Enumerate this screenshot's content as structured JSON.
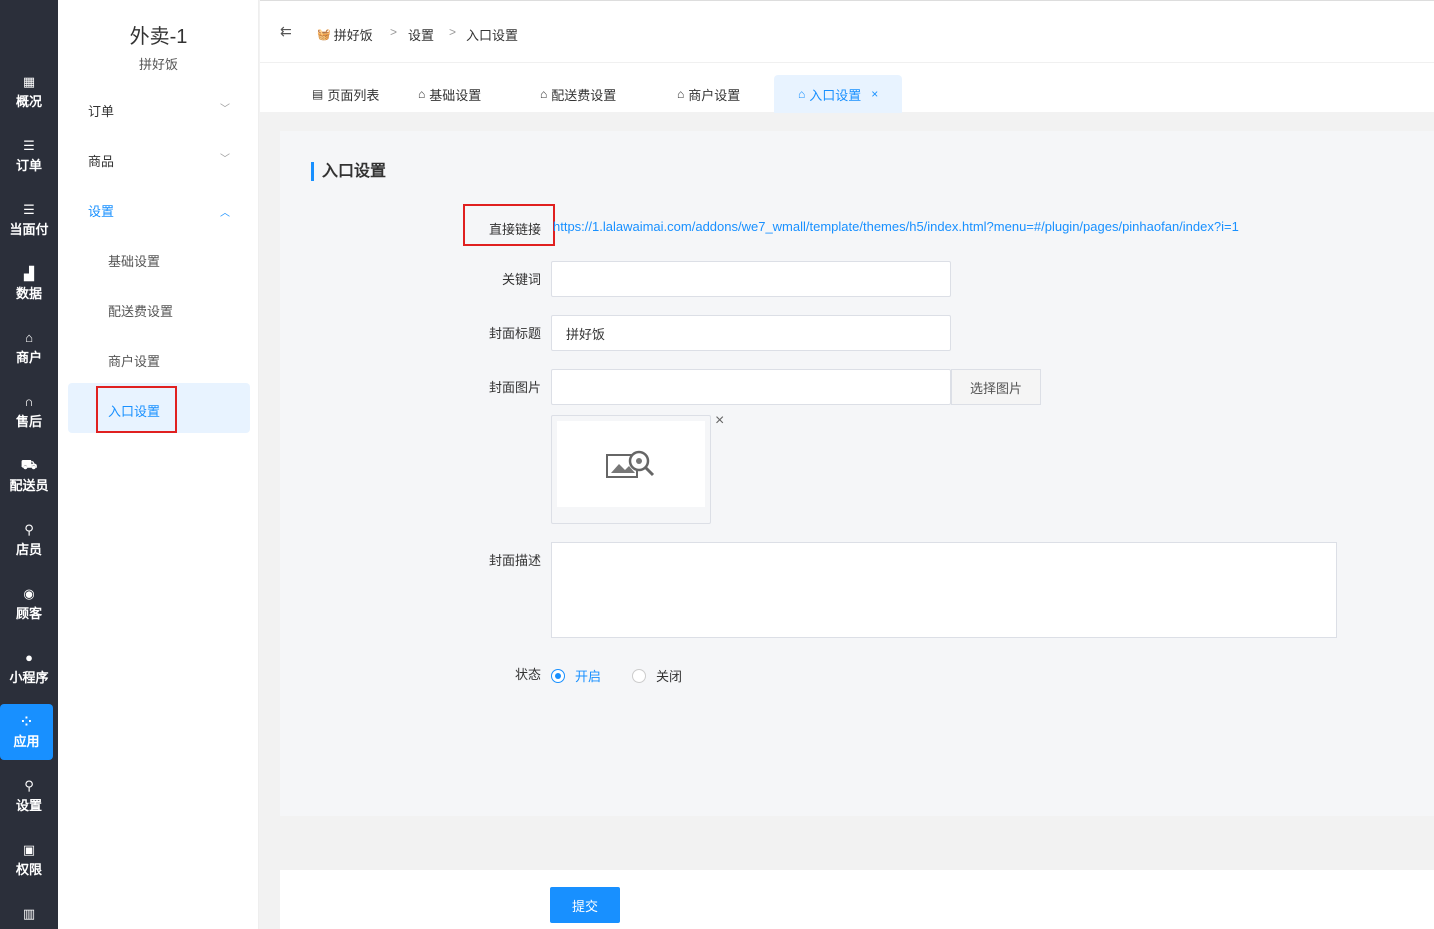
{
  "left_nav": {
    "items": [
      {
        "label": "概况",
        "icon": "dashboard-icon"
      },
      {
        "label": "订单",
        "icon": "list-icon"
      },
      {
        "label": "当面付",
        "icon": "list-icon"
      },
      {
        "label": "数据",
        "icon": "bar-chart-icon"
      },
      {
        "label": "商户",
        "icon": "store-icon"
      },
      {
        "label": "售后",
        "icon": "headset-icon"
      },
      {
        "label": "配送员",
        "icon": "scooter-icon"
      },
      {
        "label": "店员",
        "icon": "user-icon"
      },
      {
        "label": "顾客",
        "icon": "user-circle-icon"
      },
      {
        "label": "小程序",
        "icon": "wechat-icon"
      },
      {
        "label": "应用",
        "icon": "apps-icon"
      },
      {
        "label": "设置",
        "icon": "settings-user-icon"
      },
      {
        "label": "权限",
        "icon": "lock-icon"
      }
    ],
    "active": "应用"
  },
  "sub_nav": {
    "store_name": "外卖-1",
    "store_sub": "拼好饭",
    "groups": [
      {
        "label": "订单",
        "chevron": "﹀"
      },
      {
        "label": "商品",
        "chevron": "﹀"
      },
      {
        "label": "设置",
        "chevron": "︿"
      }
    ],
    "sub_items": [
      "基础设置",
      "配送费设置",
      "商户设置",
      "入口设置"
    ]
  },
  "breadcrumb": {
    "items": [
      "拼好饭",
      "设置",
      "入口设置"
    ],
    "sep": ">"
  },
  "tabs": [
    {
      "label": "页面列表"
    },
    {
      "label": "基础设置"
    },
    {
      "label": "配送费设置"
    },
    {
      "label": "商户设置"
    },
    {
      "label": "入口设置",
      "close": "×"
    }
  ],
  "form": {
    "section_title": "入口设置",
    "direct_link_label": "直接链接",
    "direct_link_value": "https://1.lalawaimai.com/addons/we7_wmall/template/themes/h5/index.html?menu=#/plugin/pages/pinhaofan/index?i=1",
    "keyword_label": "关键词",
    "keyword_value": "",
    "cover_title_label": "封面标题",
    "cover_title_value": "拼好饭",
    "cover_image_label": "封面图片",
    "cover_image_value": "",
    "select_image_button": "选择图片",
    "image_close": "×",
    "cover_desc_label": "封面描述",
    "status_label": "状态",
    "status_on": "开启",
    "status_off": "关闭",
    "status_value": "开启",
    "submit": "提交"
  },
  "colors": {
    "accent": "#1890ff",
    "highlight_box": "#e02020",
    "nav_dark": "#2b2f3a"
  }
}
